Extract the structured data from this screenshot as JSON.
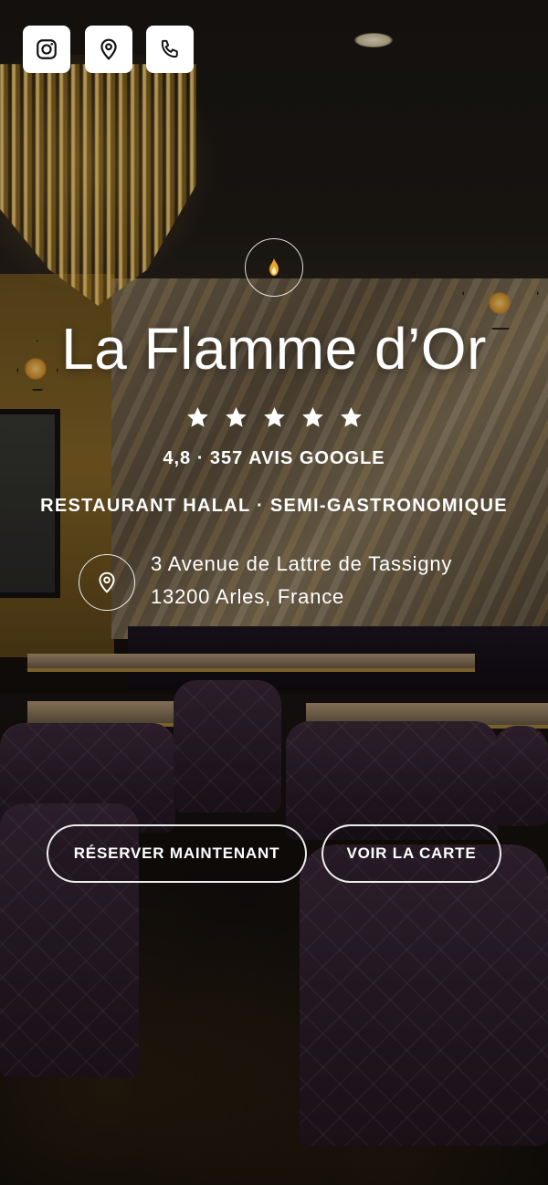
{
  "social": {
    "instagram_icon": "instagram-icon",
    "location_icon": "map-pin-icon",
    "phone_icon": "phone-icon"
  },
  "restaurant": {
    "name": "La Flamme d’Or",
    "stars": 5,
    "rating_text": "4,8 · 357 AVIS GOOGLE",
    "category": "RESTAURANT HALAL · SEMI-GASTRONOMIQUE",
    "address_line1": "3 Avenue de Lattre de Tassigny",
    "address_line2": "13200 Arles, France"
  },
  "actions": {
    "reserve_label": "RÉSERVER MAINTENANT",
    "menu_label": "VOIR LA CARTE"
  },
  "colors": {
    "text": "#ffffff",
    "flame": "#e8a42c",
    "button_border": "#ffffff"
  }
}
